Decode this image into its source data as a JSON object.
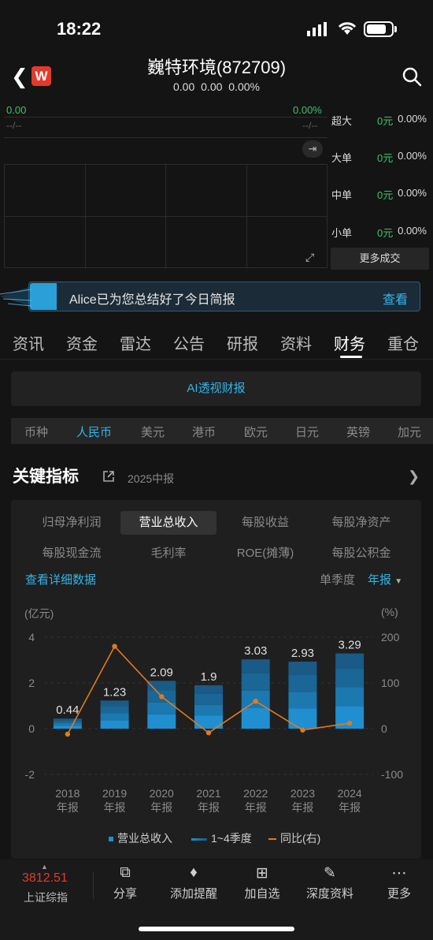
{
  "status": {
    "time": "18:22"
  },
  "header": {
    "logo": "W",
    "title": "巍特环境(872709)",
    "quote": "0.00  0.00  0.00%"
  },
  "quote_chart": {
    "left_top": "0.00",
    "right_top": "0.00%",
    "left_dash": "--/--",
    "right_dash": "--/--"
  },
  "flows": [
    {
      "label": "超大",
      "value": "0元",
      "pct": "0.00%"
    },
    {
      "label": "大单",
      "value": "0元",
      "pct": "0.00%"
    },
    {
      "label": "中单",
      "value": "0元",
      "pct": "0.00%"
    },
    {
      "label": "小单",
      "value": "0元",
      "pct": "0.00%"
    }
  ],
  "more_trade": "更多成交",
  "banner": {
    "text": "Alice已为您总结好了今日简报",
    "link": "查看"
  },
  "tabs": [
    "资讯",
    "资金",
    "雷达",
    "公告",
    "研报",
    "资料",
    "财务",
    "重仓"
  ],
  "active_tab": "财务",
  "ai_button": "AI透视财报",
  "currencies": [
    "币种",
    "人民币",
    "美元",
    "港币",
    "欧元",
    "日元",
    "英镑",
    "加元"
  ],
  "active_currency": "人民币",
  "key_metrics": {
    "title": "关键指标",
    "period": "2025中报",
    "metrics_row1": [
      "归母净利润",
      "营业总收入",
      "每股收益",
      "每股净资产"
    ],
    "metrics_row2": [
      "每股现金流",
      "毛利率",
      "ROE(摊薄)",
      "每股公积金"
    ],
    "active_metric": "营业总收入",
    "detail_link": "查看详细数据",
    "mode_quarter": "单季度",
    "mode_year": "年报"
  },
  "chart_data": {
    "type": "bar",
    "left_unit": "(亿元)",
    "right_unit": "(%)",
    "categories": [
      "2018\n年报",
      "2019\n年报",
      "2020\n年报",
      "2021\n年报",
      "2022\n年报",
      "2023\n年报",
      "2024\n年报"
    ],
    "x_years": [
      "2018",
      "2019",
      "2020",
      "2021",
      "2022",
      "2023",
      "2024"
    ],
    "x_suffix": "年报",
    "series": [
      {
        "name": "营业总收入",
        "values": [
          0.44,
          1.23,
          2.09,
          1.9,
          3.03,
          2.93,
          3.29
        ]
      },
      {
        "name": "同比(右)",
        "values": [
          -12,
          180,
          70,
          -9,
          60,
          -3,
          12
        ]
      }
    ],
    "legend": [
      "营业总收入",
      "1~4季度",
      "同比(右)"
    ],
    "y_left_ticks": [
      "4",
      "2",
      "0",
      "-2"
    ],
    "y_right_ticks": [
      "200",
      "100",
      "0",
      "-100"
    ],
    "ylim_left": [
      -2,
      4
    ],
    "ylim_right": [
      -100,
      200
    ],
    "colors": {
      "bar": "#1f8fd0",
      "bar_dark": "#1a5a86",
      "line": "#e07b20"
    }
  },
  "bottom": {
    "index_value": "3812.51",
    "index_name": "上证综指",
    "items": [
      {
        "icon": "share-icon",
        "label": "分享"
      },
      {
        "icon": "bell-icon",
        "label": "添加提醒"
      },
      {
        "icon": "plus-box-icon",
        "label": "加自选"
      },
      {
        "icon": "doc-icon",
        "label": "深度资料"
      },
      {
        "icon": "more-dots-icon",
        "label": "更多"
      }
    ]
  }
}
